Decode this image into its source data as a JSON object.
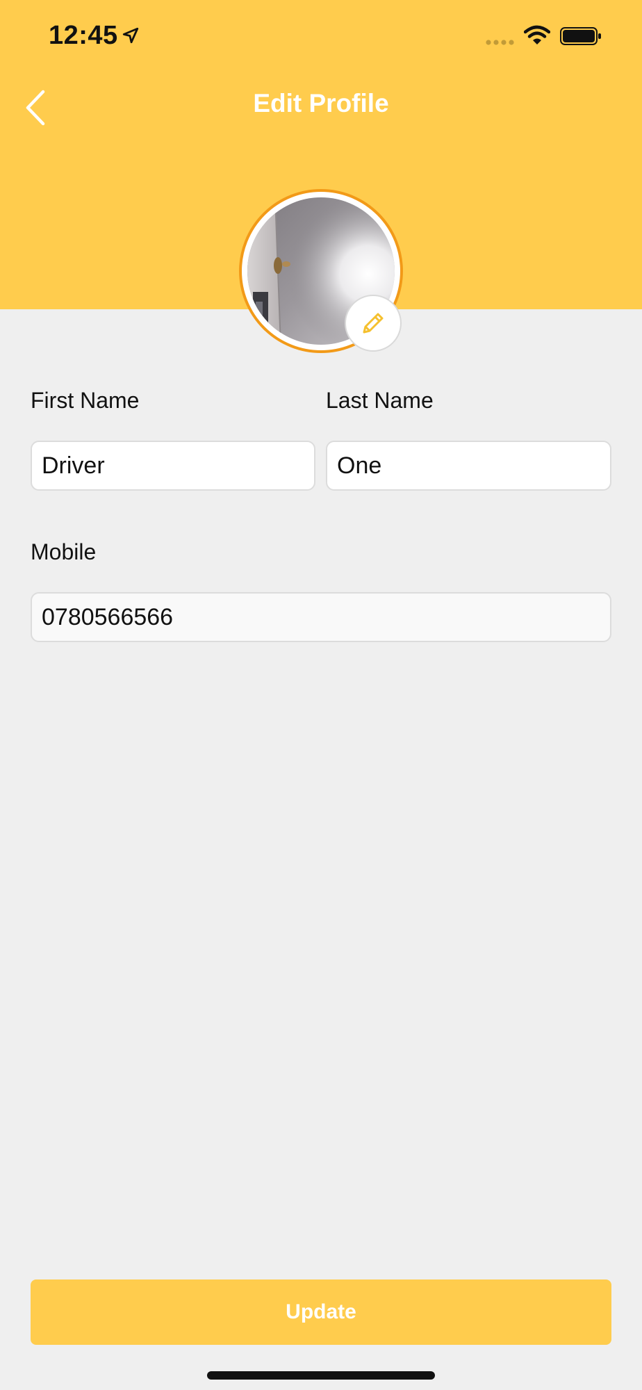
{
  "status_bar": {
    "time": "12:45",
    "icons": [
      "location-arrow-icon",
      "signal-icon",
      "wifi-icon",
      "battery-icon"
    ]
  },
  "header": {
    "title": "Edit Profile",
    "back_icon": "chevron-left-icon",
    "background_color": "#ffcc4d"
  },
  "avatar": {
    "ring_color": "#f29a18",
    "edit_icon": "pencil-icon"
  },
  "form": {
    "first_name": {
      "label": "First Name",
      "value": "Driver"
    },
    "last_name": {
      "label": "Last Name",
      "value": "One"
    },
    "mobile": {
      "label": "Mobile",
      "value": "0780566566"
    }
  },
  "actions": {
    "update_label": "Update",
    "button_color": "#ffcc4d"
  }
}
